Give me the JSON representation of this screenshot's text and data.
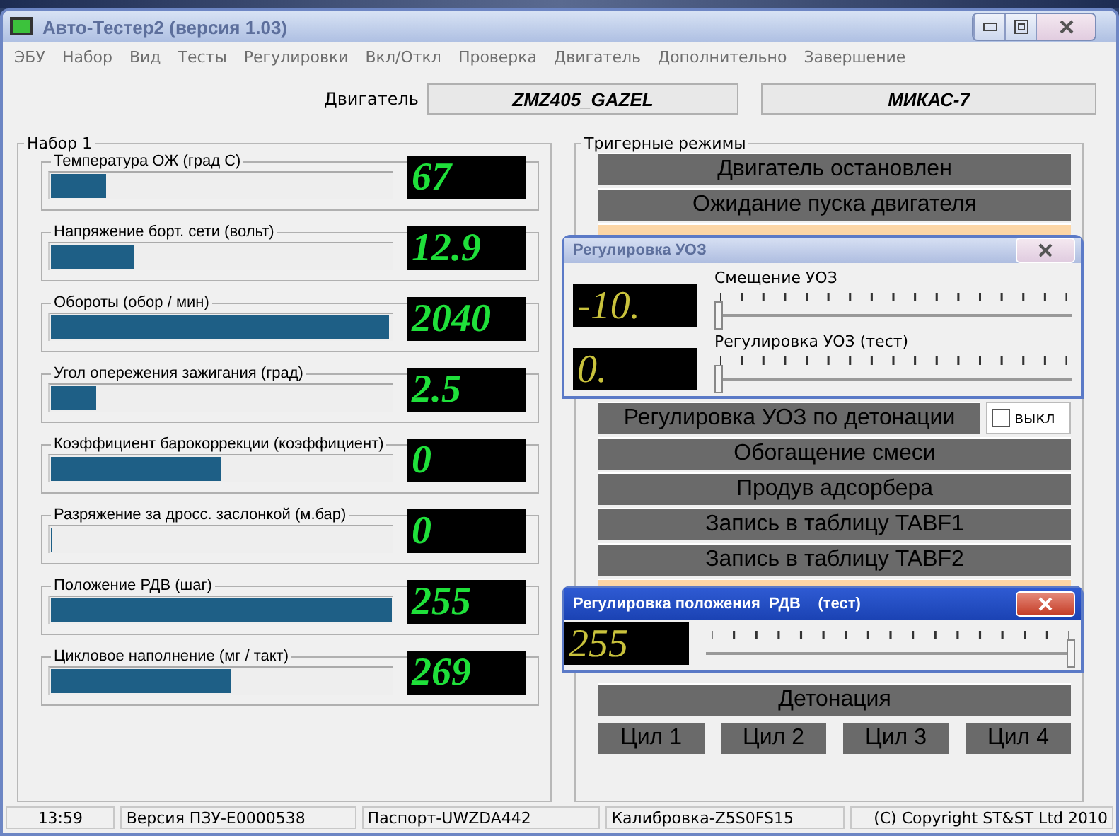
{
  "window": {
    "title": "Авто-Тестер2  (версия 1.03)"
  },
  "menu": [
    "ЭБУ",
    "Набор",
    "Вид",
    "Тесты",
    "Регулировки",
    "Вкл/Откл",
    "Проверка",
    "Двигатель",
    "Дополнительно",
    "Завершение"
  ],
  "engine": {
    "label": "Двигатель",
    "model": "ZMZ405_GAZEL",
    "controller": "МИКАС-7"
  },
  "sensor_set": {
    "title": "Набор 1",
    "sensors": [
      {
        "label": "Температура  ОЖ (град С)",
        "value": "67",
        "level": 0.17
      },
      {
        "label": "Напряжение борт. сети  (вольт)",
        "value": "12.9",
        "level": 0.25
      },
      {
        "label": "Обороты  (обор / мин)",
        "value": "2040",
        "level": 0.99
      },
      {
        "label": "Угол опережения зажигания  (град)",
        "value": "2.5",
        "level": 0.14
      },
      {
        "label": "Коэффициент барокоррекции  (коэффициент)",
        "value": "0",
        "level": 0.5
      },
      {
        "label": "Разряжение за дросс. заслонкой  (м.бар)",
        "value": "0",
        "level": 0
      },
      {
        "label": "Положение РДВ  (шаг)",
        "value": "255",
        "level": 1
      },
      {
        "label": "Цикловое наполнение  (мг / такт)",
        "value": "269",
        "level": 0.53
      }
    ]
  },
  "trigger_modes": {
    "title": "Тригерные режимы",
    "rows": [
      {
        "kind": "mode",
        "label": "Двигатель остановлен",
        "active": false
      },
      {
        "kind": "mode",
        "label": "Ожидание пуска двигателя",
        "active": false
      },
      {
        "kind": "partial",
        "active": true
      },
      {
        "kind": "mode",
        "label": "Регулировка УОЗ по детонации",
        "active": false,
        "switch": {
          "label": "выкл",
          "checked": false
        }
      },
      {
        "kind": "mode",
        "label": "Обогащение смеси",
        "active": false
      },
      {
        "kind": "mode",
        "label": "Продув адсорбера",
        "active": false
      },
      {
        "kind": "mode",
        "label": "Запись в таблицу TABF1",
        "active": false
      },
      {
        "kind": "mode",
        "label": "Запись в таблицу TABF2",
        "active": false
      },
      {
        "kind": "partial",
        "active": true
      },
      {
        "kind": "mode",
        "label": "Детонация",
        "active": false
      }
    ],
    "cylinders": [
      {
        "label": "Цил 1",
        "active": false
      },
      {
        "label": "Цил 2",
        "active": false
      },
      {
        "label": "Цил 3",
        "active": false
      },
      {
        "label": "Цил 4",
        "active": false
      }
    ]
  },
  "uoz_dialog": {
    "title": "Регулировка УОЗ",
    "focused": false,
    "sliders": [
      {
        "label": "Смещение УОЗ",
        "value": "-10.",
        "level": 0
      },
      {
        "label": "Регулировка УОЗ  (тест)",
        "value": "0.",
        "level": 0
      }
    ]
  },
  "rdv_dialog": {
    "title": "Регулировка положения  РДВ    (тест)",
    "focused": true,
    "value": "255",
    "level": 1
  },
  "status_bar": [
    "13:59",
    "Версия ПЗУ-E0000538",
    "Паспорт-UWZDA442",
    "Калибровка-Z5S0FS15",
    "(C) Copyright ST&ST Ltd 2010"
  ]
}
